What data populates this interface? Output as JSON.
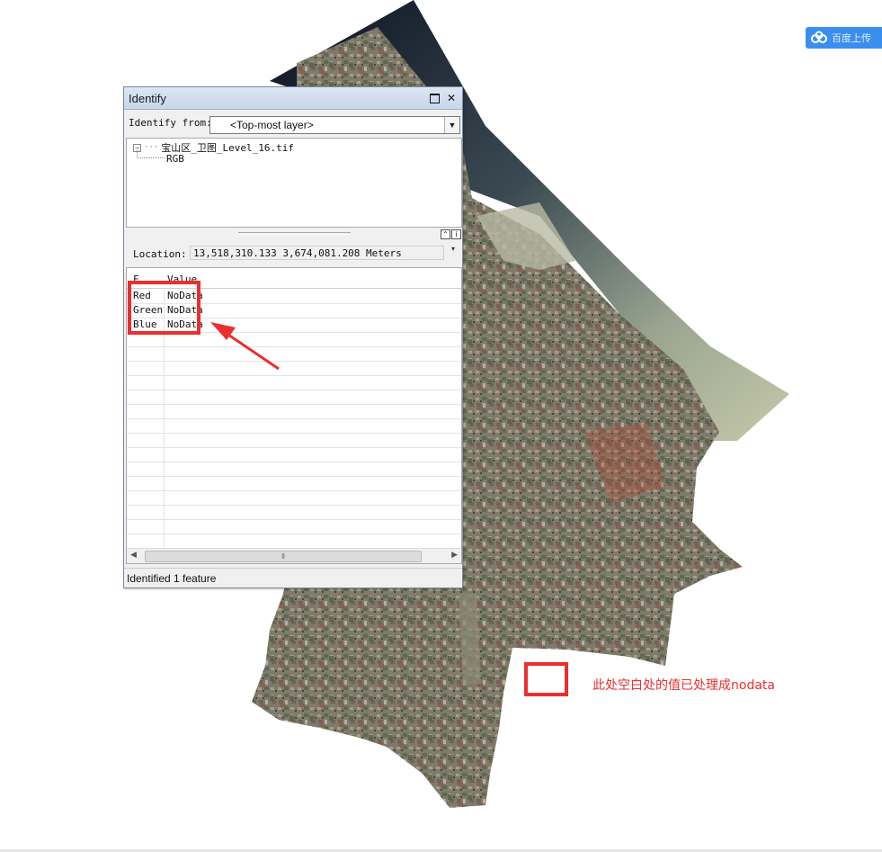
{
  "badge": {
    "label": "百度上传",
    "color": "#3a8ef0"
  },
  "window": {
    "title": "Identify",
    "identify_from_label": "Identify from:",
    "identify_from_value": "<Top-most layer>",
    "tree": {
      "layer": "宝山区_卫图_Level_16.tif",
      "child": "RGB"
    },
    "location_label": "Location:",
    "location_value": "13,518,310.133  3,674,081.208 Meters",
    "columns": [
      "F...",
      "Value"
    ],
    "rows": [
      {
        "field": "Red",
        "value": "NoData"
      },
      {
        "field": "Green",
        "value": "NoData"
      },
      {
        "field": "Blue",
        "value": "NoData"
      }
    ],
    "status": "Identified 1 feature"
  },
  "annotation": {
    "note": "此处空白处的值已处理成nodata",
    "color": "#ec2e2e"
  },
  "icons": {
    "maximize": "maximize-icon",
    "close": "close-icon",
    "dropdown": "chevron-down-icon",
    "tree_toggle": "collapse-icon"
  }
}
